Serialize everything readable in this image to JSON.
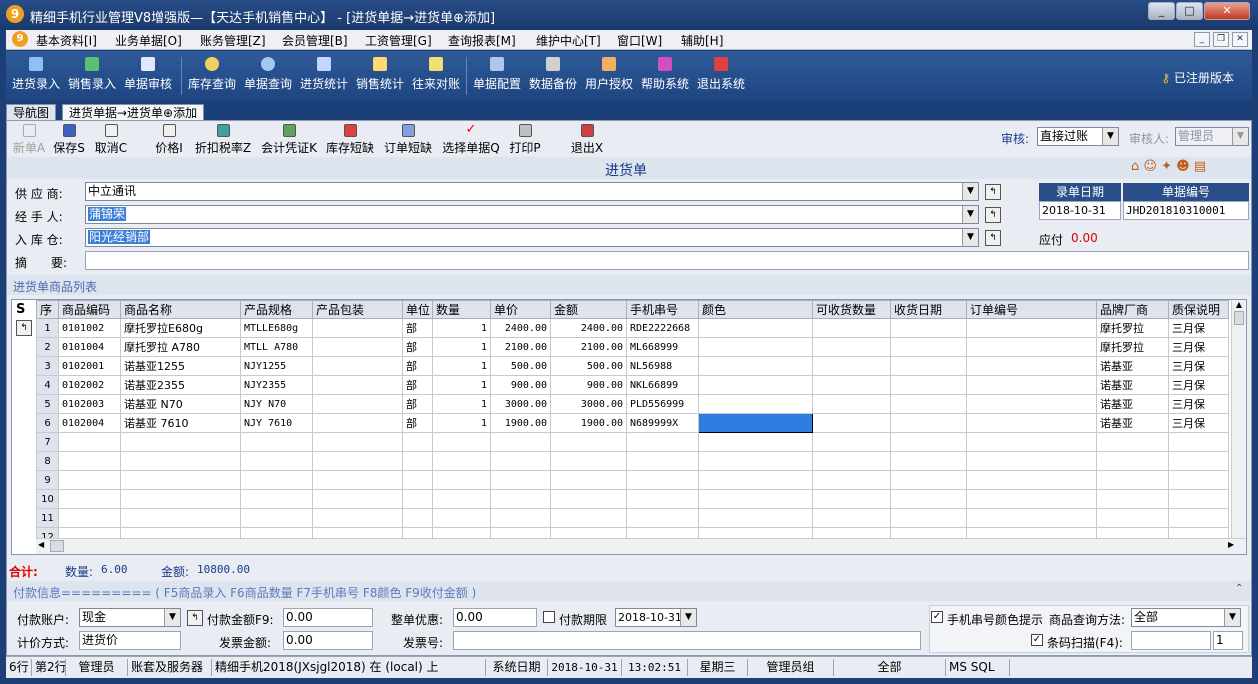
{
  "window": {
    "title": "精细手机行业管理V8增强版—【天达手机销售中心】 - [进货单据→进货单⊕添加]",
    "min": "_",
    "max": "□",
    "close": "✕"
  },
  "menu": [
    "基本资料[I]",
    "业务单据[O]",
    "账务管理[Z]",
    "会员管理[B]",
    "工资管理[G]",
    "查询报表[M]",
    "维护中心[T]",
    "窗口[W]",
    "辅助[H]"
  ],
  "mdi": {
    "min": "_",
    "restore": "❐",
    "close": "✕"
  },
  "toolbar": [
    "进货录入",
    "销售录入",
    "单据审核",
    "库存查询",
    "单据查询",
    "进货统计",
    "销售统计",
    "往来对账",
    "单据配置",
    "数据备份",
    "用户授权",
    "帮助系统",
    "退出系统"
  ],
  "registered": "已注册版本",
  "tabs": [
    "导航图",
    "进货单据→进货单⊕添加"
  ],
  "doc_toolbar": [
    "新单A",
    "保存S",
    "取消C",
    "价格I",
    "折扣税率Z",
    "会计凭证K",
    "库存短缺",
    "订单短缺",
    "选择单据Q",
    "打印P",
    "退出X"
  ],
  "audit": {
    "label": "审核:",
    "value": "直接过账",
    "auditor_label": "审核人:",
    "auditor": "管理员"
  },
  "form": {
    "title": "进货单",
    "supplier_label": "供 应 商:",
    "supplier": "中立通讯",
    "handler_label": "经 手 人:",
    "handler": "蒲锦荣",
    "warehouse_label": "入 库 仓:",
    "warehouse": "阳光经销部",
    "memo_label": "摘　　要:",
    "memo": "",
    "date_header": "录单日期",
    "date": "2018-10-31",
    "no_header": "单据编号",
    "no": "JHD201810310001",
    "payable_label": "应付",
    "payable": "0.00"
  },
  "grid_title": "进货单商品列表",
  "columns": [
    "序",
    "商品编码",
    "商品名称",
    "产品规格",
    "产品包装",
    "单位",
    "数量",
    "单价",
    "金额",
    "手机串号",
    "颜色",
    "可收货数量",
    "收货日期",
    "订单编号",
    "品牌厂商",
    "质保说明"
  ],
  "rows": [
    [
      "1",
      "0101002",
      "摩托罗拉E680g",
      "MTLLE680g",
      "",
      "部",
      "1",
      "2400.00",
      "2400.00",
      "RDE2222668",
      "",
      "",
      "",
      "",
      "摩托罗拉",
      "三月保"
    ],
    [
      "2",
      "0101004",
      "摩托罗拉 A780",
      "MTLL A780",
      "",
      "部",
      "1",
      "2100.00",
      "2100.00",
      "ML668999",
      "",
      "",
      "",
      "",
      "摩托罗拉",
      "三月保"
    ],
    [
      "3",
      "0102001",
      "诺基亚1255",
      "NJY1255",
      "",
      "部",
      "1",
      "500.00",
      "500.00",
      "NL56988",
      "",
      "",
      "",
      "",
      "诺基亚",
      "三月保"
    ],
    [
      "4",
      "0102002",
      "诺基亚2355",
      "NJY2355",
      "",
      "部",
      "1",
      "900.00",
      "900.00",
      "NKL66899",
      "",
      "",
      "",
      "",
      "诺基亚",
      "三月保"
    ],
    [
      "5",
      "0102003",
      "诺基亚 N70",
      "NJY N70",
      "",
      "部",
      "1",
      "3000.00",
      "3000.00",
      "PLD556999",
      "",
      "",
      "",
      "",
      "诺基亚",
      "三月保"
    ],
    [
      "6",
      "0102004",
      "诺基亚 7610",
      "NJY 7610",
      "",
      "部",
      "1",
      "1900.00",
      "1900.00",
      "N689999X",
      "",
      "",
      "",
      "",
      "诺基亚",
      "三月保"
    ],
    [
      "7"
    ],
    [
      "8"
    ],
    [
      "9"
    ],
    [
      "10"
    ],
    [
      "11"
    ],
    [
      "12"
    ]
  ],
  "totals": {
    "label": "合计:",
    "qty_label": "数量:",
    "qty": "6.00",
    "amount_label": "金额:",
    "amount": "10800.00"
  },
  "payment_hint": "付款信息========= ( F5商品录入 F6商品数量 F7手机串号 F8颜色 F9收付金额 )",
  "payment": {
    "account_label": "付款账户:",
    "account": "现金",
    "amount_label": "付款金额F9:",
    "amount": "0.00",
    "discount_label": "整单优惠:",
    "discount": "0.00",
    "term_label": "付款期限",
    "term_date": "2018-10-31",
    "pricing_label": "计价方式:",
    "pricing": "进货价",
    "invoice_amount_label": "发票金额:",
    "invoice_amount": "0.00",
    "invoice_no_label": "发票号:",
    "invoice_no": "",
    "color_hint": "手机串号颜色提示",
    "query_method_label": "商品查询方法:",
    "query_method": "全部",
    "barcode": "条码扫描(F4):",
    "barcode_count": "1"
  },
  "status": [
    "6行",
    "第2行",
    "管理员",
    "账套及服务器",
    "精细手机2018(JXsjgl2018) 在 (local) 上",
    "系统日期",
    "2018-10-31",
    "13:02:51",
    "星期三",
    "管理员组",
    "全部",
    "MS SQL"
  ]
}
